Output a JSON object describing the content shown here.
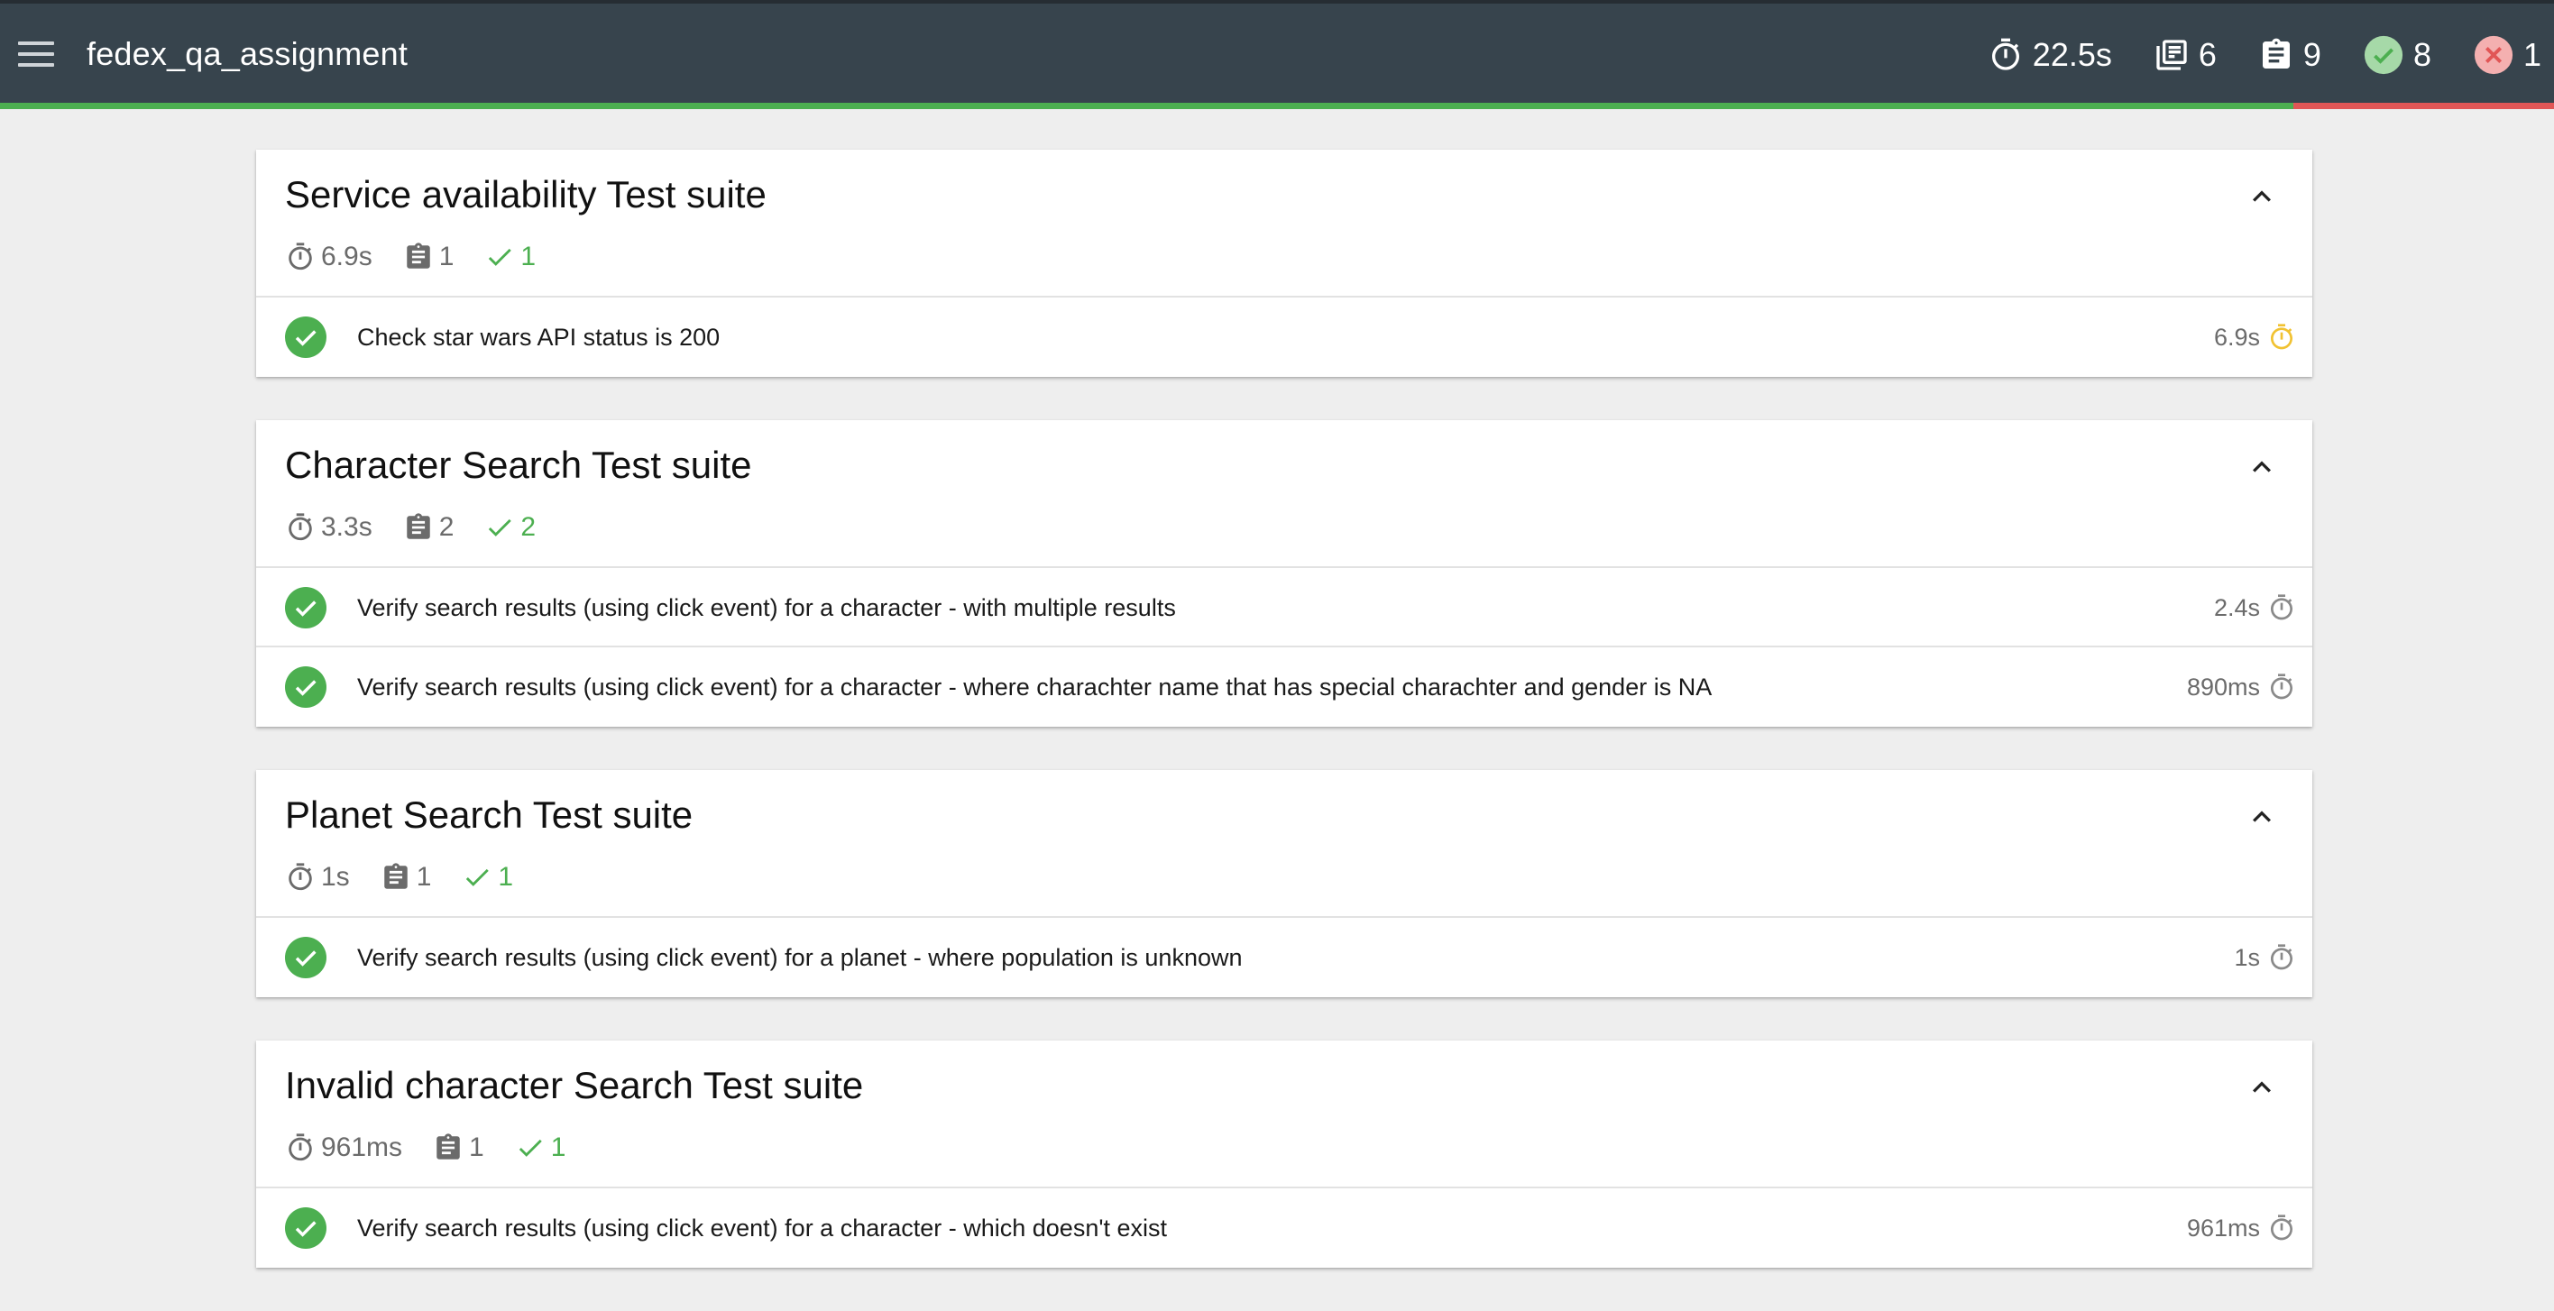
{
  "app": {
    "title": "fedex_qa_assignment"
  },
  "summary": {
    "duration": "22.5s",
    "suites": "6",
    "tests": "9",
    "passed": "8",
    "failed": "1",
    "pass_fraction": 0.898
  },
  "colors": {
    "header_bg": "#37444d",
    "pass": "#4caf50",
    "fail": "#e15656",
    "slow": "#f1c232",
    "muted": "#6b6b6b"
  },
  "suites": [
    {
      "title": "Service availability Test suite",
      "duration": "6.9s",
      "tests": "1",
      "passed": "1",
      "items": [
        {
          "name": "Check star wars API status is 200",
          "duration": "6.9s",
          "speed": "slow"
        }
      ]
    },
    {
      "title": "Character Search Test suite",
      "duration": "3.3s",
      "tests": "2",
      "passed": "2",
      "items": [
        {
          "name": "Verify search results (using click event) for a character - with multiple results",
          "duration": "2.4s",
          "speed": "normal"
        },
        {
          "name": "Verify search results (using click event) for a character - where charachter name that has special charachter and gender is NA",
          "duration": "890ms",
          "speed": "normal"
        }
      ]
    },
    {
      "title": "Planet Search Test suite",
      "duration": "1s",
      "tests": "1",
      "passed": "1",
      "items": [
        {
          "name": "Verify search results (using click event) for a planet - where population is unknown",
          "duration": "1s",
          "speed": "normal"
        }
      ]
    },
    {
      "title": "Invalid character Search Test suite",
      "duration": "961ms",
      "tests": "1",
      "passed": "1",
      "items": [
        {
          "name": "Verify search results (using click event) for a character - which doesn't exist",
          "duration": "961ms",
          "speed": "normal"
        }
      ]
    }
  ]
}
